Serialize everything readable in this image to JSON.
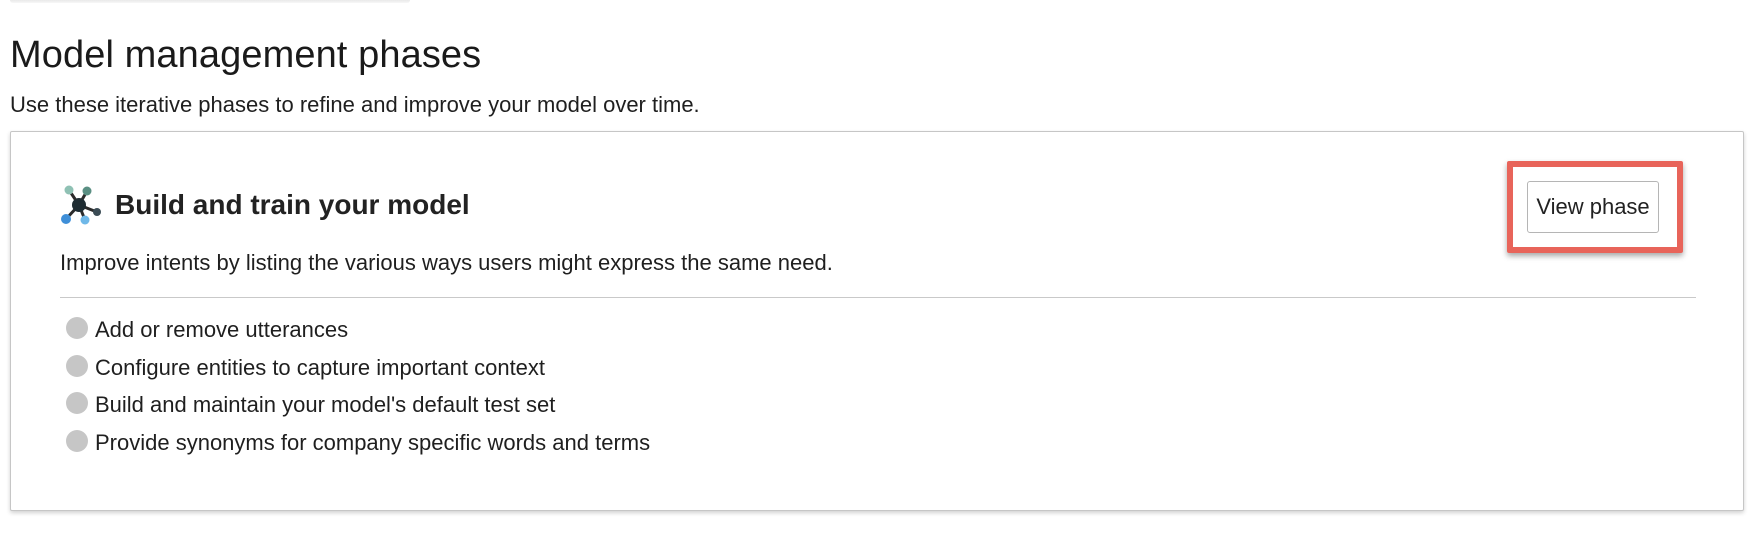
{
  "section": {
    "title": "Model management phases",
    "description": "Use these iterative phases to refine and improve your model over time."
  },
  "phase_card": {
    "icon": "model-network-icon",
    "title": "Build and train your model",
    "description": "Improve intents by listing the various ways users might express the same need.",
    "button_label": "View phase",
    "highlight_color": "#e8645a",
    "steps": [
      "Add or remove utterances",
      "Configure entities to capture important context",
      "Build and maintain your model's default test set",
      "Provide synonyms for company specific words and terms"
    ]
  }
}
